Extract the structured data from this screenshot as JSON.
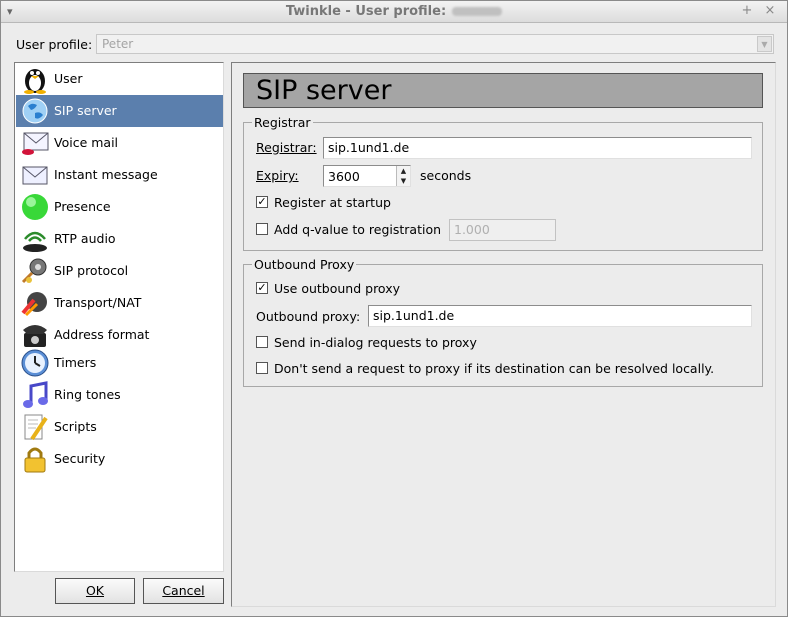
{
  "window": {
    "title": "Twinkle - User profile:",
    "icon": "window-menu-icon",
    "controls": [
      "+",
      "×"
    ]
  },
  "profile": {
    "label": "User profile:",
    "value": "Peter"
  },
  "sidebar": {
    "items": [
      {
        "label": "User",
        "icon": "tux-user-icon"
      },
      {
        "label": "SIP server",
        "icon": "globe-icon",
        "selected": true
      },
      {
        "label": "Voice mail",
        "icon": "voicemail-envelope-icon"
      },
      {
        "label": "Instant message",
        "icon": "envelope-icon"
      },
      {
        "label": "Presence",
        "icon": "presence-green-ball-icon"
      },
      {
        "label": "RTP audio",
        "icon": "rtp-audio-icon"
      },
      {
        "label": "SIP protocol",
        "icon": "sip-protocol-gear-icon"
      },
      {
        "label": "Transport/NAT",
        "icon": "transport-nat-icon"
      },
      {
        "label": "Address format",
        "icon": "telephone-icon"
      },
      {
        "label": "Timers",
        "icon": "clock-icon"
      },
      {
        "label": "Ring tones",
        "icon": "music-note-icon"
      },
      {
        "label": "Scripts",
        "icon": "script-pencil-icon"
      },
      {
        "label": "Security",
        "icon": "padlock-icon"
      }
    ]
  },
  "buttons": {
    "ok": "OK",
    "cancel": "Cancel"
  },
  "panel": {
    "title": "SIP server",
    "registrar_group": {
      "legend": "Registrar",
      "registrar_label": "Registrar:",
      "registrar_value": "sip.1und1.de",
      "expiry_label": "Expiry:",
      "expiry_value": "3600",
      "expiry_unit": "seconds",
      "register_at_startup_label": "Register at startup",
      "register_at_startup_checked": true,
      "add_qvalue_label": "Add q-value to registration",
      "add_qvalue_checked": false,
      "qvalue": "1.000"
    },
    "outbound_group": {
      "legend": "Outbound Proxy",
      "use_outbound_label": "Use outbound proxy",
      "use_outbound_checked": true,
      "outbound_proxy_label": "Outbound proxy:",
      "outbound_proxy_value": "sip.1und1.de",
      "in_dialog_label": "Send in-dialog requests to proxy",
      "in_dialog_checked": false,
      "dont_send_label": "Don't send a request to proxy if its destination can be resolved locally.",
      "dont_send_checked": false
    }
  }
}
